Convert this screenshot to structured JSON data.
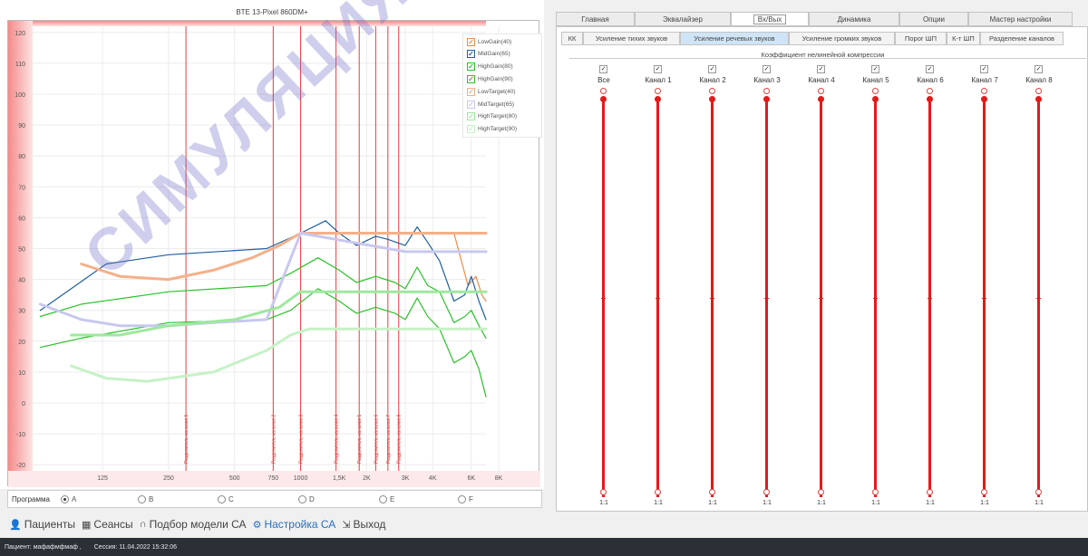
{
  "chart_title": "BTE 13-Pixel 860DM+",
  "chart_data": {
    "type": "line",
    "title": "BTE 13-Pixel 860DM+",
    "xscale": "log",
    "xlim": [
      60,
      7000
    ],
    "ylim": [
      -22,
      122
    ],
    "x_ticks": [
      {
        "v": 125,
        "t": "125"
      },
      {
        "v": 250,
        "t": "250"
      },
      {
        "v": 500,
        "t": "500"
      },
      {
        "v": 750,
        "t": "750"
      },
      {
        "v": 1000,
        "t": "1000"
      },
      {
        "v": 1500,
        "t": "1,5K"
      },
      {
        "v": 2000,
        "t": "2K"
      },
      {
        "v": 3000,
        "t": "3K"
      },
      {
        "v": 4000,
        "t": "4K"
      },
      {
        "v": 6000,
        "t": "6K"
      },
      {
        "v": 8000,
        "t": "8K"
      }
    ],
    "y_ticks": [
      -20,
      -10,
      0,
      10,
      20,
      30,
      40,
      50,
      60,
      70,
      80,
      90,
      100,
      110,
      120
    ],
    "crossovers": [
      {
        "freq": 300,
        "label": "Разделитель каналов 1"
      },
      {
        "freq": 750,
        "label": "Разделитель каналов 2"
      },
      {
        "freq": 1000,
        "label": "Разделитель каналов 3"
      },
      {
        "freq": 1450,
        "label": "Разделитель каналов 4"
      },
      {
        "freq": 1850,
        "label": "Разделитель каналов 5"
      },
      {
        "freq": 2200,
        "label": "Разделитель каналов 6"
      },
      {
        "freq": 2500,
        "label": "Разделитель каналов 7"
      },
      {
        "freq": 2800,
        "label": "Разделитель каналов 8"
      }
    ],
    "series": [
      {
        "name": "LowGain(40)",
        "color": "#f08a4b",
        "width": 1.2,
        "points": [
          [
            1050,
            55
          ],
          [
            2000,
            55
          ],
          [
            3000,
            55
          ],
          [
            4000,
            55
          ],
          [
            5000,
            55
          ],
          [
            5800,
            38
          ],
          [
            6300,
            41
          ],
          [
            6700,
            35
          ],
          [
            7000,
            33
          ]
        ]
      },
      {
        "name": "MidGain(65)",
        "color": "#1f5f9e",
        "width": 1.2,
        "points": [
          [
            65,
            30
          ],
          [
            90,
            37
          ],
          [
            130,
            45
          ],
          [
            250,
            48
          ],
          [
            700,
            50
          ],
          [
            1000,
            55
          ],
          [
            1300,
            59
          ],
          [
            1500,
            55
          ],
          [
            1800,
            51
          ],
          [
            2200,
            54
          ],
          [
            2500,
            53
          ],
          [
            3000,
            51
          ],
          [
            3400,
            57
          ],
          [
            3800,
            52
          ],
          [
            4300,
            46
          ],
          [
            5000,
            33
          ],
          [
            5600,
            35
          ],
          [
            6000,
            41
          ],
          [
            6500,
            33
          ],
          [
            7000,
            27
          ]
        ]
      },
      {
        "name": "HighGain(80)",
        "color": "#2ac22a",
        "width": 1.2,
        "points": [
          [
            65,
            28
          ],
          [
            100,
            32
          ],
          [
            250,
            36
          ],
          [
            700,
            38
          ],
          [
            900,
            42
          ],
          [
            1200,
            47
          ],
          [
            1500,
            43
          ],
          [
            1800,
            39
          ],
          [
            2200,
            41
          ],
          [
            2700,
            39
          ],
          [
            3000,
            37
          ],
          [
            3400,
            44
          ],
          [
            3800,
            38
          ],
          [
            4300,
            36
          ],
          [
            5000,
            26
          ],
          [
            5600,
            28
          ],
          [
            6000,
            30
          ],
          [
            6500,
            25
          ],
          [
            7000,
            21
          ]
        ]
      },
      {
        "name": "HighGain(90)",
        "color": "#2ac22a",
        "width": 1.2,
        "points": [
          [
            65,
            18
          ],
          [
            100,
            21
          ],
          [
            250,
            26
          ],
          [
            700,
            27
          ],
          [
            900,
            30
          ],
          [
            1200,
            37
          ],
          [
            1500,
            33
          ],
          [
            1800,
            29
          ],
          [
            2200,
            31
          ],
          [
            2700,
            29
          ],
          [
            3000,
            27
          ],
          [
            3400,
            34
          ],
          [
            3800,
            28
          ],
          [
            4300,
            24
          ],
          [
            5000,
            13
          ],
          [
            5600,
            15
          ],
          [
            6000,
            17
          ],
          [
            6500,
            11
          ],
          [
            7000,
            2
          ]
        ]
      },
      {
        "name": "LowTarget(40)",
        "color": "#f4b089",
        "width": 3,
        "points": [
          [
            100,
            45
          ],
          [
            150,
            41
          ],
          [
            250,
            40
          ],
          [
            400,
            43
          ],
          [
            600,
            47
          ],
          [
            800,
            51
          ],
          [
            1000,
            55
          ],
          [
            2000,
            55
          ],
          [
            4000,
            55
          ],
          [
            7000,
            55
          ]
        ]
      },
      {
        "name": "MidTarget(65)",
        "color": "#c8c8ef",
        "width": 3,
        "points": [
          [
            65,
            32
          ],
          [
            100,
            27
          ],
          [
            150,
            25
          ],
          [
            250,
            25
          ],
          [
            400,
            26
          ],
          [
            700,
            27
          ],
          [
            1000,
            55
          ],
          [
            3000,
            49
          ],
          [
            7000,
            49
          ]
        ]
      },
      {
        "name": "HighTarget(80)",
        "color": "#9ee89e",
        "width": 3,
        "points": [
          [
            90,
            22
          ],
          [
            150,
            22
          ],
          [
            250,
            25
          ],
          [
            500,
            27
          ],
          [
            800,
            31
          ],
          [
            1000,
            36
          ],
          [
            2000,
            36
          ],
          [
            4000,
            36
          ],
          [
            7000,
            36
          ]
        ]
      },
      {
        "name": "HighTarget(90)",
        "color": "#c6f2c6",
        "width": 3,
        "points": [
          [
            90,
            12
          ],
          [
            130,
            8
          ],
          [
            200,
            7
          ],
          [
            400,
            10
          ],
          [
            700,
            17
          ],
          [
            900,
            22
          ],
          [
            1100,
            24
          ],
          [
            2000,
            24
          ],
          [
            4000,
            24
          ],
          [
            7000,
            24
          ]
        ]
      }
    ]
  },
  "legend": [
    {
      "label": "LowGain(40)",
      "color": "#f08a4b"
    },
    {
      "label": "MidGain(65)",
      "color": "#1f5f9e"
    },
    {
      "label": "HighGain(80)",
      "color": "#2ac22a"
    },
    {
      "label": "HighGain(90)",
      "color": "#2ac22a"
    },
    {
      "label": "LowTarget(40)",
      "color": "#f4b089"
    },
    {
      "label": "MidTarget(65)",
      "color": "#c8c8ef"
    },
    {
      "label": "HighTarget(80)",
      "color": "#9ee89e"
    },
    {
      "label": "HighTarget(90)",
      "color": "#c6f2c6"
    }
  ],
  "watermark": "СИМУЛЯЦИЯ",
  "program": {
    "label": "Программа",
    "options": [
      {
        "label": "A",
        "selected": true
      },
      {
        "label": "B",
        "selected": false
      },
      {
        "label": "C",
        "selected": false
      },
      {
        "label": "D",
        "selected": false
      },
      {
        "label": "E",
        "selected": false
      },
      {
        "label": "F",
        "selected": false
      }
    ]
  },
  "nav": {
    "patients": "Пациенты",
    "sessions": "Сеансы",
    "model_select": "Подбор модели СА",
    "settings": "Настройка СА",
    "exit": "Выход"
  },
  "status": {
    "patient": "Пациент: мафафмфмаф ,",
    "session": "Сессия: 11.04.2022 15:32:06"
  },
  "tabs_top": [
    "Главная",
    "Эквалайзер",
    "Вх/Вых",
    "Динамика",
    "Опции",
    "Мастер настройки"
  ],
  "tabs_sub": [
    "КК",
    "Усиление тихих звуков",
    "Усиление речевых звуков",
    "Усиление громких звуков",
    "Порог ШП",
    "К-т ШП",
    "Разделение каналов"
  ],
  "section_title": "Коэффициент нелинейной компрессии",
  "channels": [
    {
      "label": "Все",
      "checked": "✓",
      "ratio": "1:1"
    },
    {
      "label": "Канал 1",
      "checked": "✓",
      "ratio": "1:1"
    },
    {
      "label": "Канал 2",
      "checked": "✓",
      "ratio": "1:1"
    },
    {
      "label": "Канал 3",
      "checked": "✓",
      "ratio": "1:1"
    },
    {
      "label": "Канал 4",
      "checked": "✓",
      "ratio": "1:1"
    },
    {
      "label": "Канал 5",
      "checked": "✓",
      "ratio": "1:1"
    },
    {
      "label": "Канал 6",
      "checked": "✓",
      "ratio": "1:1"
    },
    {
      "label": "Канал 7",
      "checked": "✓",
      "ratio": "1:1"
    },
    {
      "label": "Канал 8",
      "checked": "✓",
      "ratio": "1:1"
    }
  ]
}
